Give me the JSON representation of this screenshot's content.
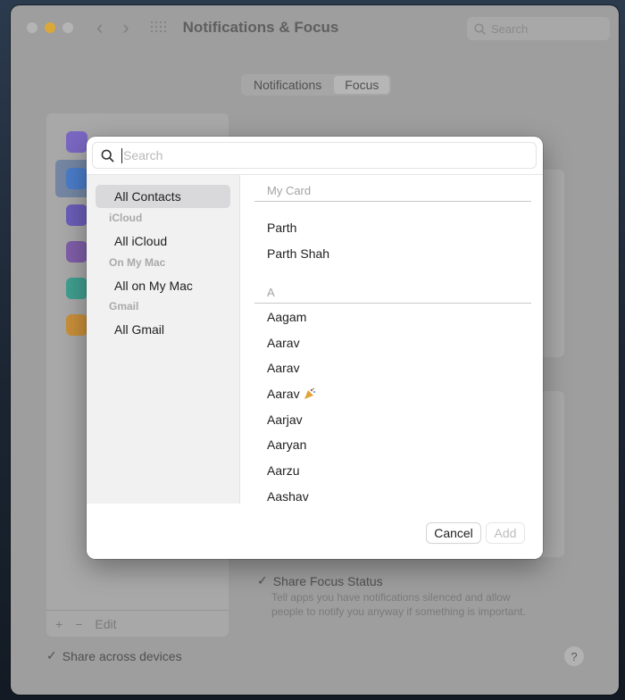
{
  "window": {
    "title": "Notifications & Focus",
    "search_placeholder": "Search"
  },
  "tabs": [
    {
      "label": "Notifications",
      "active": false
    },
    {
      "label": "Focus",
      "active": true
    }
  ],
  "left_panel": {
    "toolbar": {
      "add": "+",
      "remove": "−",
      "edit": "Edit"
    },
    "focus_icons": [
      {
        "icon": "moon-icon",
        "color": "#7a67c2"
      },
      {
        "icon": "smiley-icon",
        "color": "#4a7cc9"
      },
      {
        "icon": "car-icon",
        "color": "#6a5db8"
      },
      {
        "icon": "person-icon",
        "color": "#7f5ea8"
      },
      {
        "icon": "bed-icon",
        "color": "#3f9e8f"
      },
      {
        "icon": "gamepad-icon",
        "color": "#c88f3a"
      }
    ]
  },
  "share_focus": {
    "label": "Share Focus Status",
    "description_line1": "Tell apps you have notifications silenced and allow",
    "description_line2": "people to notify you anyway if something is important."
  },
  "share_devices": {
    "label": "Share across devices"
  },
  "help": "?",
  "modal": {
    "search_placeholder": "Search",
    "sidebar": {
      "all_contacts": "All Contacts",
      "icloud_header": "iCloud",
      "all_icloud": "All iCloud",
      "onmymac_header": "On My Mac",
      "all_onmymac": "All on My Mac",
      "gmail_header": "Gmail",
      "all_gmail": "All Gmail"
    },
    "sections": {
      "my_card": "My Card",
      "a": "A"
    },
    "my_card_contacts": [
      "Parth",
      "Parth Shah"
    ],
    "a_contacts": [
      "Aagam",
      "Aarav",
      "Aarav",
      "Aarav",
      "Aarjav",
      "Aaryan",
      "Aarzu",
      "Aashav"
    ],
    "buttons": {
      "cancel": "Cancel",
      "add": "Add"
    }
  }
}
